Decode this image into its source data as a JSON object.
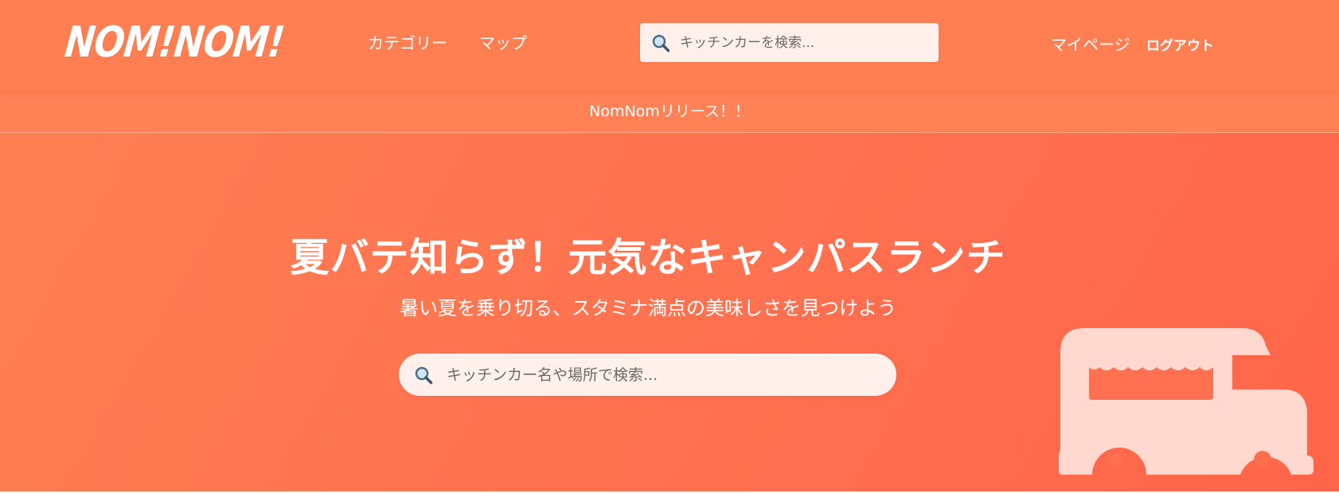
{
  "header": {
    "logo_text": "NOM!NOM!",
    "nav": {
      "categories": "カテゴリー",
      "map": "マップ",
      "mypage": "マイページ",
      "logout": "ログアウト"
    },
    "search": {
      "placeholder": "キッチンカーを検索..."
    }
  },
  "announcement": {
    "text": "NomNomリリース！！"
  },
  "hero": {
    "title": "夏バテ知らず！元気なキャンパスランチ",
    "subtitle": "暑い夏を乗り切る、スタミナ満点の美味しさを見つけよう",
    "search": {
      "placeholder": "キッチンカー名や場所で検索..."
    }
  },
  "icons": {
    "search": "search-icon",
    "truck": "food-truck-icon"
  },
  "colors": {
    "brand": "#ff7f52",
    "hero_gradient_end": "#ff6549",
    "search_bg": "#fff0ec",
    "text_on_brand": "#ffffff"
  }
}
